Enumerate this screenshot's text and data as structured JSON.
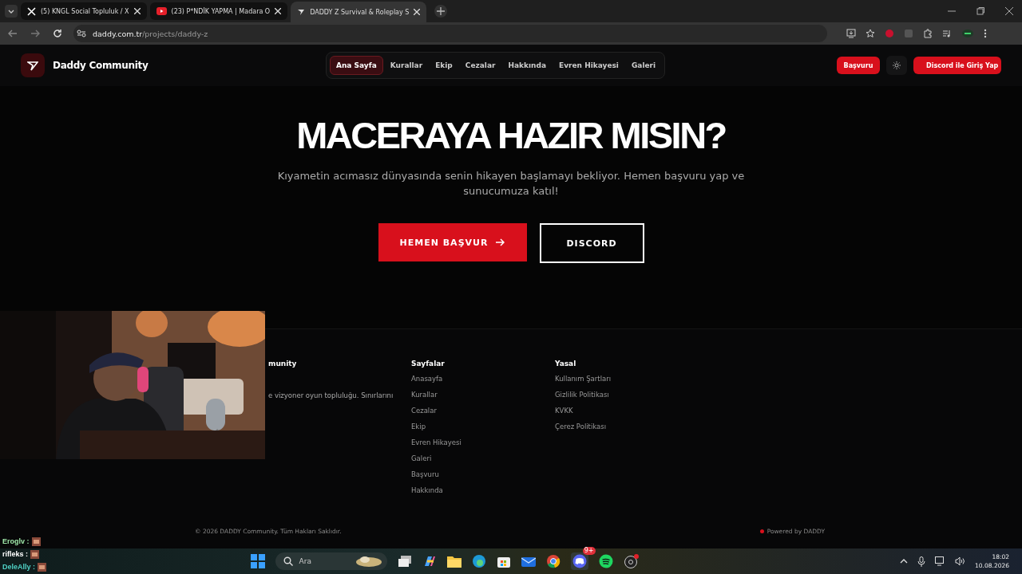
{
  "browser": {
    "tabs": [
      {
        "title": "(5) KNGL Social Topluluk / X",
        "kind": "x",
        "selected": false
      },
      {
        "title": "(23) P*NDİK YAPMA | Madara O",
        "kind": "video",
        "selected": false
      },
      {
        "title": "DADDY Z Survival & Roleplay S",
        "kind": "site",
        "selected": true
      }
    ],
    "url_host": "daddy.com.tr",
    "url_path": "/projects/daddy-z"
  },
  "header": {
    "brand": "Daddy Community",
    "nav": [
      {
        "label": "Ana Sayfa",
        "selected": true
      },
      {
        "label": "Kurallar",
        "selected": false
      },
      {
        "label": "Ekip",
        "selected": false
      },
      {
        "label": "Cezalar",
        "selected": false
      },
      {
        "label": "Hakkında",
        "selected": false
      },
      {
        "label": "Evren Hikayesi",
        "selected": false
      },
      {
        "label": "Galeri",
        "selected": false
      }
    ],
    "apply_button": "Başvuru",
    "discord_button": "Discord ile Giriş Yap"
  },
  "hero": {
    "title": "MACERAYA HAZIR MISIN?",
    "subtitle": "Kıyametin acımasız dünyasında senin hikayen başlamayı bekliyor. Hemen başvuru yap ve sunucumuza katıl!",
    "primary_button": "HEMEN BAŞVUR",
    "secondary_button": "DISCORD"
  },
  "footer": {
    "brand_fragment": "munity",
    "about_fragment": "e vizyoner oyun topluluğu. Sınırlarını",
    "columns": [
      {
        "heading": "Sayfalar",
        "links": [
          "Anasayfa",
          "Kurallar",
          "Cezalar",
          "Ekip",
          "Evren Hikayesi",
          "Galeri",
          "Başvuru",
          "Hakkında"
        ]
      },
      {
        "heading": "Yasal",
        "links": [
          "Kullanım Şartları",
          "Gizlilik Politikası",
          "KVKK",
          "Çerez Politikası"
        ]
      }
    ],
    "copyright": "© 2026 DADDY Community. Tüm Hakları Saklıdır.",
    "powered": "Powered by DADDY"
  },
  "chat": [
    {
      "user": "Eroglv :",
      "color": "#9ee6a8"
    },
    {
      "user": "rifleks :",
      "color": "#ffffff"
    },
    {
      "user": "DeleAlly :",
      "color": "#4fd1c5"
    }
  ],
  "taskbar": {
    "search_placeholder": "Ara",
    "discord_badge": "9+",
    "time": "18:02",
    "date": "10.08.2026"
  }
}
